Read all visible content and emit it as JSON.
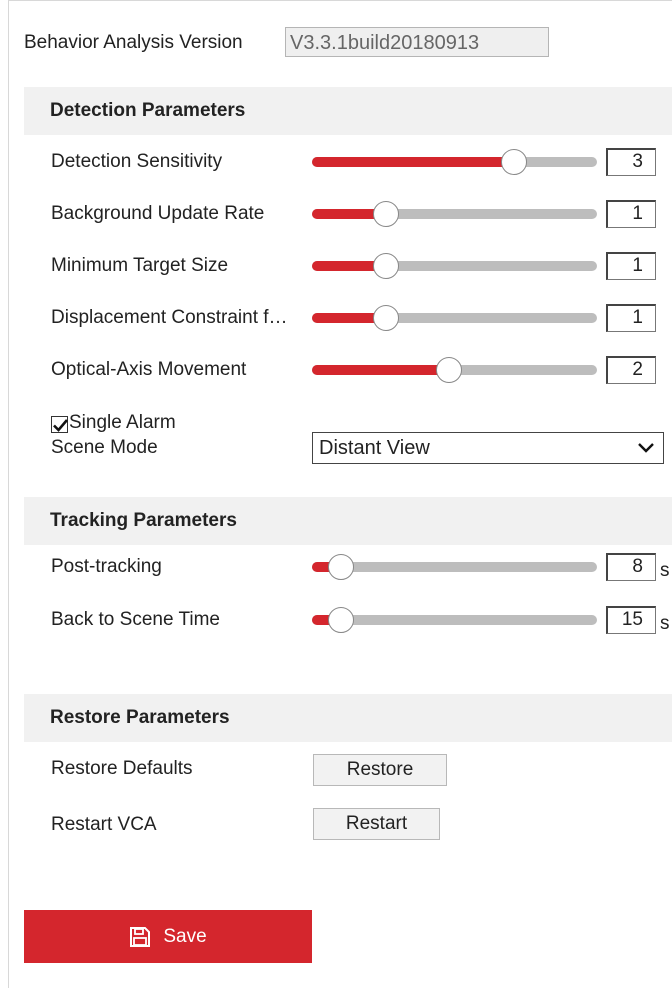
{
  "version": {
    "label": "Behavior Analysis Version",
    "value": "V3.3.1build20180913"
  },
  "detection": {
    "title": "Detection Parameters",
    "params": [
      {
        "label": "Detection Sensitivity",
        "value": "3",
        "fraction": 0.71
      },
      {
        "label": "Background Update Rate",
        "value": "1",
        "fraction": 0.26
      },
      {
        "label": "Minimum Target Size",
        "value": "1",
        "fraction": 0.26
      },
      {
        "label": "Displacement Constraint f…",
        "value": "1",
        "fraction": 0.26
      },
      {
        "label": "Optical-Axis Movement",
        "value": "2",
        "fraction": 0.48
      }
    ],
    "single_alarm": {
      "label": "Single Alarm",
      "checked": true
    },
    "scene_mode": {
      "label": "Scene Mode",
      "selected": "Distant View"
    }
  },
  "tracking": {
    "title": "Tracking Parameters",
    "params": [
      {
        "label": "Post-tracking",
        "value": "8",
        "unit": "s",
        "fraction": 0.1
      },
      {
        "label": "Back to Scene Time",
        "value": "15",
        "unit": "s",
        "fraction": 0.1
      }
    ]
  },
  "restore": {
    "title": "Restore Parameters",
    "defaults": {
      "label": "Restore Defaults",
      "button": "Restore"
    },
    "vca": {
      "label": "Restart VCA",
      "button": "Restart"
    }
  },
  "save": {
    "label": "Save"
  },
  "colors": {
    "accent": "#d4262d",
    "track": "#bdbdbd",
    "section_bg": "#f1f1f1"
  },
  "icons": {
    "save": "floppy-disk-icon",
    "dropdown": "chevron-down-icon",
    "checkbox": "checkmark-icon"
  }
}
